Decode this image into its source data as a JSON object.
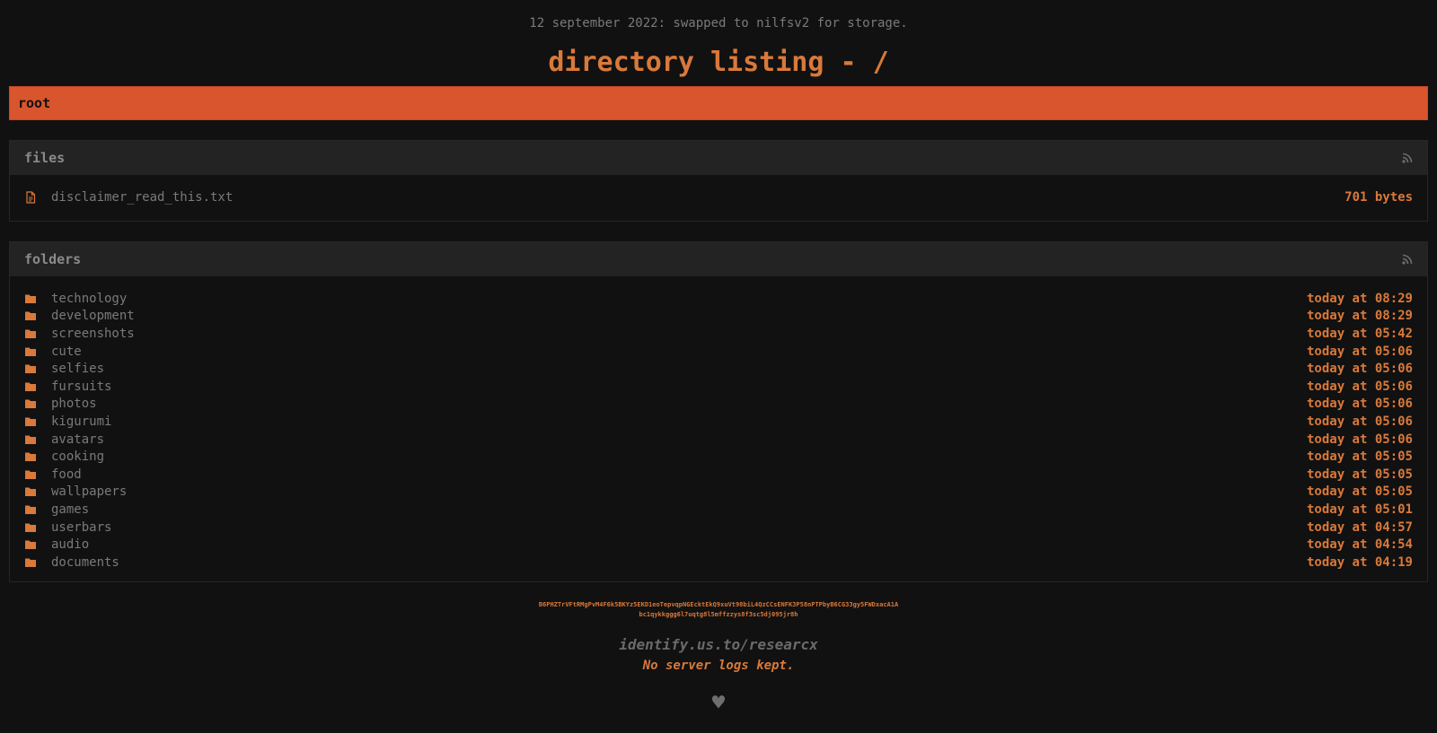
{
  "notice": "12 september 2022: swapped to nilfsv2 for storage.",
  "title": "directory listing - /",
  "breadcrumb": "root",
  "files": {
    "heading": "files",
    "items": [
      {
        "name": "disclaimer_read_this.txt",
        "size": "701 bytes",
        "icon": "document-icon"
      }
    ]
  },
  "folders": {
    "heading": "folders",
    "items": [
      {
        "name": "technology",
        "modified": "today at 08:29"
      },
      {
        "name": "development",
        "modified": "today at 08:29"
      },
      {
        "name": "screenshots",
        "modified": "today at 05:42"
      },
      {
        "name": "cute",
        "modified": "today at 05:06"
      },
      {
        "name": "selfies",
        "modified": "today at 05:06"
      },
      {
        "name": "fursuits",
        "modified": "today at 05:06"
      },
      {
        "name": "photos",
        "modified": "today at 05:06"
      },
      {
        "name": "kigurumi",
        "modified": "today at 05:06"
      },
      {
        "name": "avatars",
        "modified": "today at 05:06"
      },
      {
        "name": "cooking",
        "modified": "today at 05:05"
      },
      {
        "name": "food",
        "modified": "today at 05:05"
      },
      {
        "name": "wallpapers",
        "modified": "today at 05:05"
      },
      {
        "name": "games",
        "modified": "today at 05:01"
      },
      {
        "name": "userbars",
        "modified": "today at 04:57"
      },
      {
        "name": "audio",
        "modified": "today at 04:54"
      },
      {
        "name": "documents",
        "modified": "today at 04:19"
      }
    ]
  },
  "footer": {
    "key_line1": "B6PHZTrVFtRMgPvM4F6k5BKYz5EKD1eoTepvqpNGEcktEkQ9xuVt98biL4QzCCsENFK3P58nPTPbyB6CG33gy5FWDxacA1A",
    "key_line2": "bc1qykkggg6l7uqtg8l5mffzzys8f3sc5dj095jr8h",
    "site": "identify.us.to/researcx",
    "nolog": "No server logs kept.",
    "heart": "♥"
  },
  "colors": {
    "accent": "#d9793a",
    "breadcrumb_bg": "#d9552e",
    "background": "#111111"
  }
}
